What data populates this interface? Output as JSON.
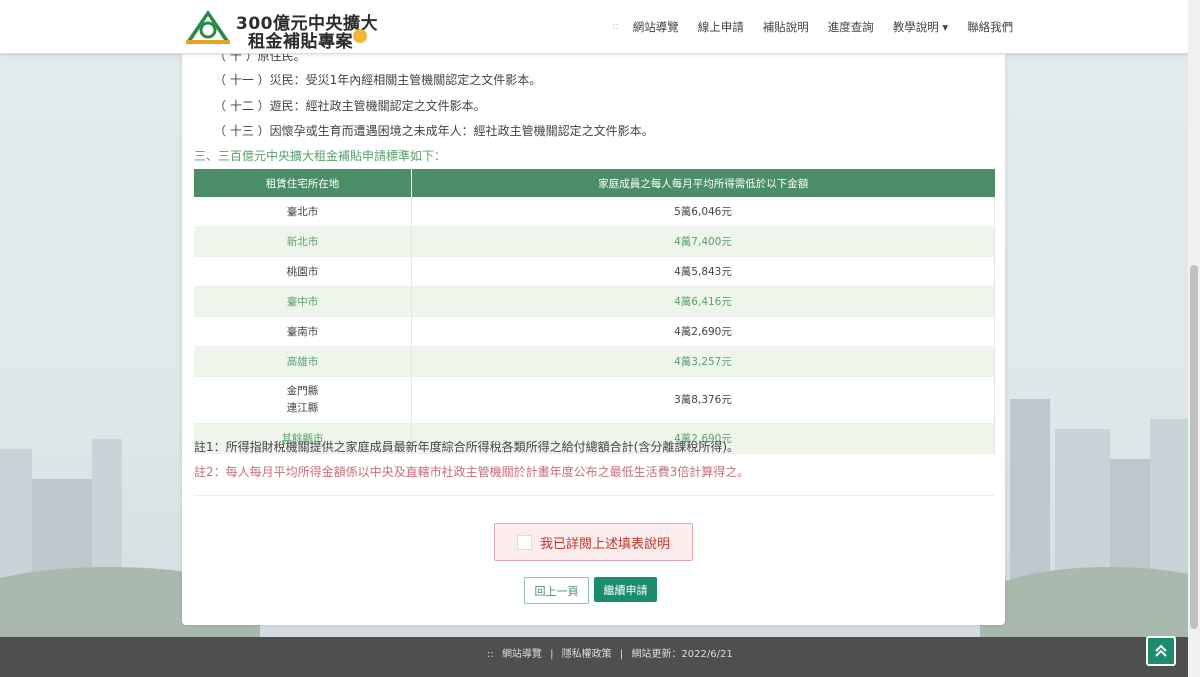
{
  "header": {
    "logo_line1": "300億元中央擴大",
    "logo_line2": "租金補貼專案",
    "nav_separator": "::",
    "nav": [
      "網站導覽",
      "線上申請",
      "補貼說明",
      "進度查詢",
      "教學說明 ▾",
      "聯絡我們"
    ]
  },
  "content": {
    "lines": [
      "（ 十 ）原住民。",
      "（ 十一 ）災民：受災1年內經相關主管機關認定之文件影本。",
      "（ 十二 ）遊民：經社政主管機關認定之文件影本。",
      "（ 十三 ）因懷孕或生育而遭遇困境之未成年人：經社政主管機關認定之文件影本。"
    ],
    "section3": "三、三百億元中央擴大租金補貼申請標準如下：",
    "table": {
      "headers": [
        "租賃住宅所在地",
        "家庭成員之每人每月平均所得需低於以下金額"
      ],
      "rows": [
        {
          "area": "臺北市",
          "amount": "5萬6,046元"
        },
        {
          "area": "新北市",
          "amount": "4萬7,400元"
        },
        {
          "area": "桃園市",
          "amount": "4萬5,843元"
        },
        {
          "area": "臺中市",
          "amount": "4萬6,416元"
        },
        {
          "area": "臺南市",
          "amount": "4萬2,690元"
        },
        {
          "area": "高雄市",
          "amount": "4萬3,257元"
        },
        {
          "area": "金門縣",
          "area2": "連江縣",
          "amount": "3萬8,376元"
        },
        {
          "area": "其餘縣市",
          "amount": "4萬2,690元"
        }
      ]
    },
    "note1": "註1：所得指財稅機關提供之家庭成員最新年度綜合所得稅各類所得之給付總額合計(含分離課稅所得)。",
    "note2": "註2：每人每月平均所得金額係以中央及直轄市社政主管機關於計畫年度公布之最低生活費3倍計算得之。",
    "confirm_label": "我已詳閱上述填表說明",
    "back_button": "回上一頁",
    "next_button": "繼續申請"
  },
  "footer": {
    "separator": "::",
    "sitemap": "網站導覽",
    "privacy": "隱私權政策",
    "updated": "網站更新：2022/6/21"
  },
  "colors": {
    "accent": "#1c8c6e",
    "table_header": "#4a8d67",
    "note_red": "#c6707a",
    "footer_bg": "#4f4f4f"
  }
}
